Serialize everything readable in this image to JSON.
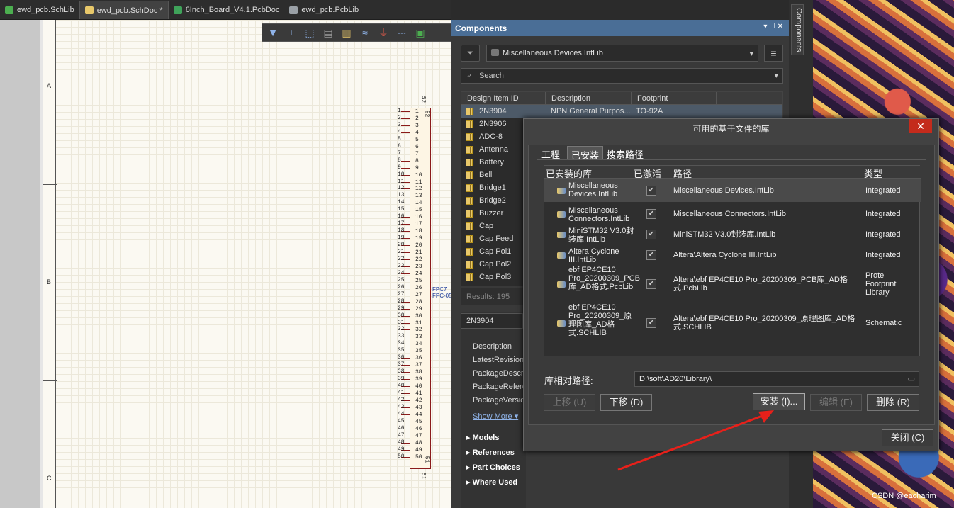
{
  "tabs": [
    {
      "label": "ewd_pcb.SchLib",
      "color": "#4caf50"
    },
    {
      "label": "ewd_pcb.SchDoc *",
      "color": "#e8c86a"
    },
    {
      "label": "6Inch_Board_V4.1.PcbDoc",
      "color": "#3fa35a"
    },
    {
      "label": "ewd_pcb.PcbLib",
      "color": "#9aa0a6"
    }
  ],
  "schematic": {
    "zones": [
      "A",
      "B",
      "C"
    ],
    "label1": "FPC7",
    "label2": "FPC-05",
    "pin_top_a": "52",
    "pin_top_b": "52",
    "pin_bot_a": "51",
    "pin_bot_b": "51",
    "pins": [
      "1",
      "2",
      "3",
      "4",
      "5",
      "6",
      "7",
      "8",
      "9",
      "10",
      "11",
      "12",
      "13",
      "14",
      "15",
      "16",
      "17",
      "18",
      "19",
      "20",
      "21",
      "22",
      "23",
      "24",
      "25",
      "26",
      "27",
      "28",
      "29",
      "30",
      "31",
      "32",
      "33",
      "34",
      "35",
      "36",
      "37",
      "38",
      "39",
      "40",
      "41",
      "42",
      "43",
      "44",
      "45",
      "46",
      "47",
      "48",
      "49",
      "50"
    ]
  },
  "panel": {
    "title": "Components",
    "library": "Miscellaneous Devices.IntLib",
    "search_placeholder": "Search",
    "columns": [
      "Design Item ID",
      "Description",
      "Footprint"
    ],
    "rows": [
      {
        "id": "2N3904",
        "desc": "NPN General Purpos...",
        "fp": "TO-92A"
      },
      {
        "id": "2N3906",
        "desc": "",
        "fp": ""
      },
      {
        "id": "ADC-8",
        "desc": "",
        "fp": ""
      },
      {
        "id": "Antenna",
        "desc": "",
        "fp": ""
      },
      {
        "id": "Battery",
        "desc": "",
        "fp": ""
      },
      {
        "id": "Bell",
        "desc": "",
        "fp": ""
      },
      {
        "id": "Bridge1",
        "desc": "",
        "fp": ""
      },
      {
        "id": "Bridge2",
        "desc": "",
        "fp": ""
      },
      {
        "id": "Buzzer",
        "desc": "",
        "fp": ""
      },
      {
        "id": "Cap",
        "desc": "",
        "fp": ""
      },
      {
        "id": "Cap Feed",
        "desc": "",
        "fp": ""
      },
      {
        "id": "Cap Pol1",
        "desc": "",
        "fp": ""
      },
      {
        "id": "Cap Pol2",
        "desc": "",
        "fp": ""
      },
      {
        "id": "Cap Pol3",
        "desc": "",
        "fp": ""
      }
    ],
    "results": "Results: 195",
    "detail_name": "2N3904",
    "detail_labels": [
      "Description",
      "LatestRevision",
      "PackageDescr",
      "PackageRefere",
      "PackageVersio"
    ],
    "show_more": "Show More",
    "sections": [
      "Models",
      "References",
      "Part Choices",
      "Where Used"
    ],
    "side_tab": "Components"
  },
  "dialog": {
    "title": "可用的基于文件的库",
    "tabs": [
      "工程",
      "已安装",
      "搜索路径"
    ],
    "columns": [
      "已安装的库",
      "已激活",
      "路径",
      "类型"
    ],
    "libs": [
      {
        "name": "Miscellaneous Devices.IntLib",
        "active": "✔",
        "path": "Miscellaneous Devices.IntLib",
        "type": "Integrated"
      },
      {
        "name": "Miscellaneous Connectors.IntLib",
        "active": "✔",
        "path": "Miscellaneous Connectors.IntLib",
        "type": "Integrated"
      },
      {
        "name": "MiniSTM32 V3.0封装库.IntLib",
        "active": "✔",
        "path": "MiniSTM32 V3.0封装库.IntLib",
        "type": "Integrated"
      },
      {
        "name": "Altera Cyclone III.IntLib",
        "active": "✔",
        "path": "Altera\\Altera Cyclone III.IntLib",
        "type": "Integrated"
      },
      {
        "name": "ebf EP4CE10 Pro_20200309_PCB库_AD格式.PcbLib",
        "active": "✔",
        "path": "Altera\\ebf EP4CE10 Pro_20200309_PCB库_AD格式.PcbLib",
        "type": "Protel Footprint Library"
      },
      {
        "name": "ebf EP4CE10 Pro_20200309_原理图库_AD格式.SCHLIB",
        "active": "✔",
        "path": "Altera\\ebf EP4CE10 Pro_20200309_原理图库_AD格式.SCHLIB",
        "type": "Schematic"
      }
    ],
    "rel_path_label": "库相对路径:",
    "rel_path": "D:\\soft\\AD20\\Library\\",
    "btn_up": "上移 (U)",
    "btn_down": "下移 (D)",
    "btn_install": "安装 (I)...",
    "btn_edit": "编辑 (E)",
    "btn_delete": "删除 (R)",
    "btn_close": "关闭 (C)"
  },
  "watermark": "CSDN @eacharim"
}
